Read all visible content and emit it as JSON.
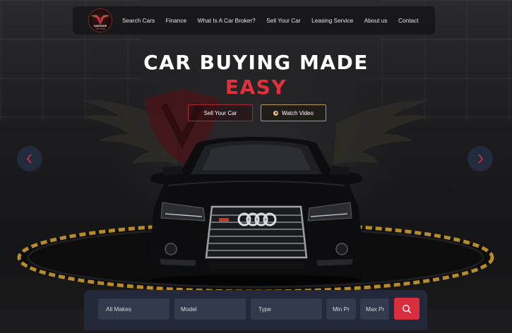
{
  "brand": {
    "logo_text": "VANTAGE",
    "logo_subtext": "Auto Group"
  },
  "nav": {
    "items": [
      {
        "label": "Search Cars"
      },
      {
        "label": "Finance"
      },
      {
        "label": "What Is A Car Broker?"
      },
      {
        "label": "Sell Your Car"
      },
      {
        "label": "Leasing Service"
      },
      {
        "label": "About us"
      },
      {
        "label": "Contact"
      }
    ]
  },
  "hero": {
    "title_line1": "CAR BUYING MADE",
    "title_line2": "EASY",
    "sell_button": "Sell Your Car",
    "video_button": "Watch Video",
    "prev_icon": "chevron-left-icon",
    "next_icon": "chevron-right-icon"
  },
  "search": {
    "makes": "All Makes",
    "model": "Model",
    "type": "Type",
    "min_price": "Min Pr",
    "max_price": "Max Pr",
    "button_icon": "search-icon"
  },
  "colors": {
    "accent_red": "#e0303c",
    "accent_gold": "#e5c07b",
    "search_button": "#d92e3d",
    "search_bar": "#23283a"
  }
}
